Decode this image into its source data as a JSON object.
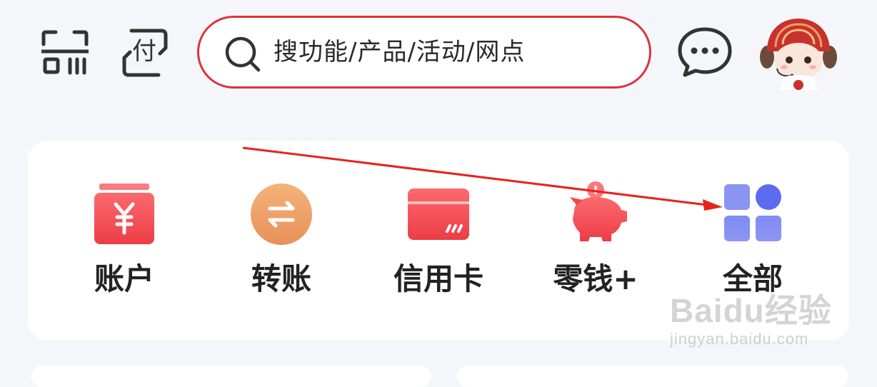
{
  "header": {
    "scan_icon": "scan-icon",
    "pay_icon_text": "付",
    "search": {
      "placeholder": "搜功能/产品/活动/网点"
    },
    "message_icon": "message-icon",
    "avatar_icon": "mascot-avatar"
  },
  "functions": [
    {
      "label": "账户",
      "icon": "wallet-yuan-icon",
      "color": "#f0474f"
    },
    {
      "label": "转账",
      "icon": "transfer-arrows-icon",
      "color": "#f0a060"
    },
    {
      "label": "信用卡",
      "icon": "credit-card-icon",
      "color": "#f0474f"
    },
    {
      "label": "零钱+",
      "icon": "piggy-bank-icon",
      "color": "#f0474f"
    },
    {
      "label": "全部",
      "icon": "all-grid-icon",
      "color": "#6b77ef"
    }
  ],
  "annotation": {
    "color": "#e8231d"
  },
  "watermark": {
    "line1": "Baidu经验",
    "line2": "jingyan.baidu.com"
  }
}
